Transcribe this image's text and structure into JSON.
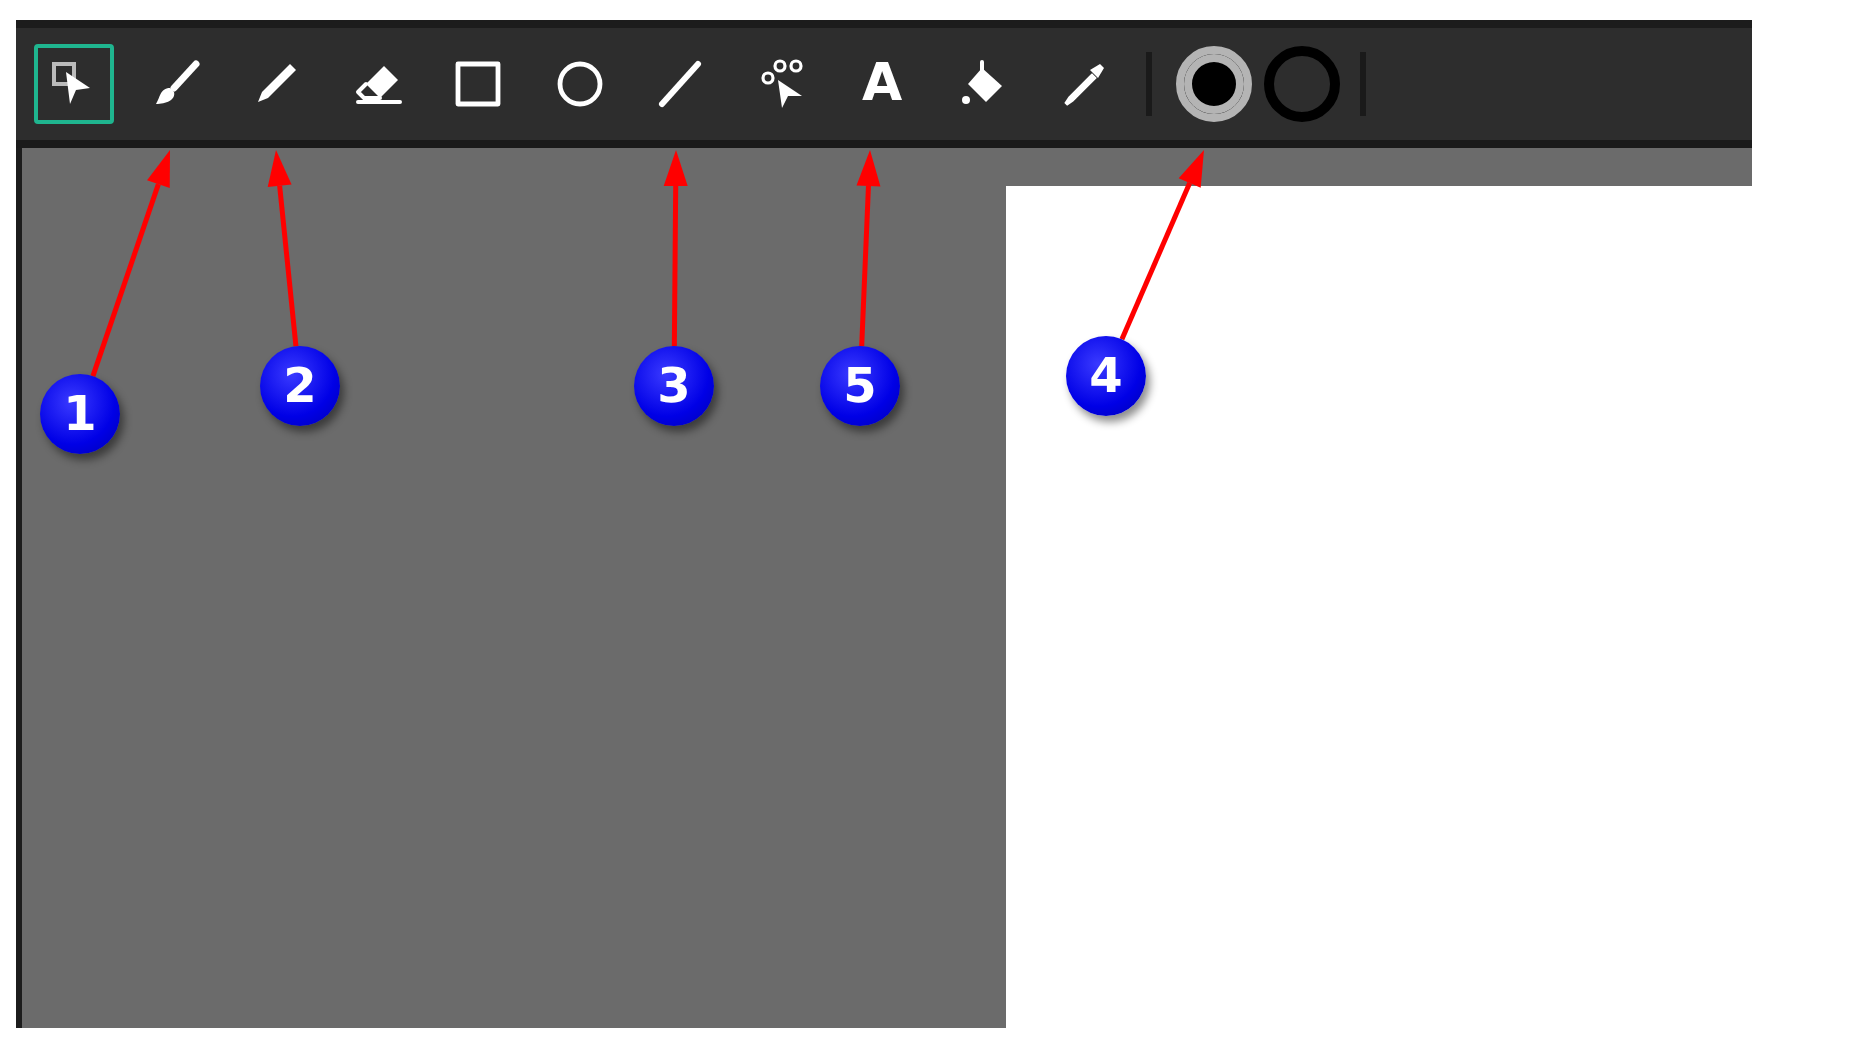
{
  "toolbar": {
    "tools": [
      {
        "kind": "select",
        "selected": true
      },
      {
        "kind": "brush",
        "selected": false
      },
      {
        "kind": "pencil",
        "selected": false
      },
      {
        "kind": "eraser",
        "selected": false
      },
      {
        "kind": "rectangle",
        "selected": false
      },
      {
        "kind": "ellipse",
        "selected": false
      },
      {
        "kind": "line",
        "selected": false
      },
      {
        "kind": "node",
        "selected": false
      },
      {
        "kind": "text",
        "selected": false,
        "label": "A"
      },
      {
        "kind": "bucket",
        "selected": false
      },
      {
        "kind": "dropper",
        "selected": false
      }
    ],
    "swatches": [
      {
        "kind": "fill",
        "selected": true
      },
      {
        "kind": "stroke",
        "selected": false
      }
    ]
  },
  "callouts": [
    {
      "label": "1"
    },
    {
      "label": "2"
    },
    {
      "label": "3"
    },
    {
      "label": "5"
    },
    {
      "label": "4"
    }
  ]
}
